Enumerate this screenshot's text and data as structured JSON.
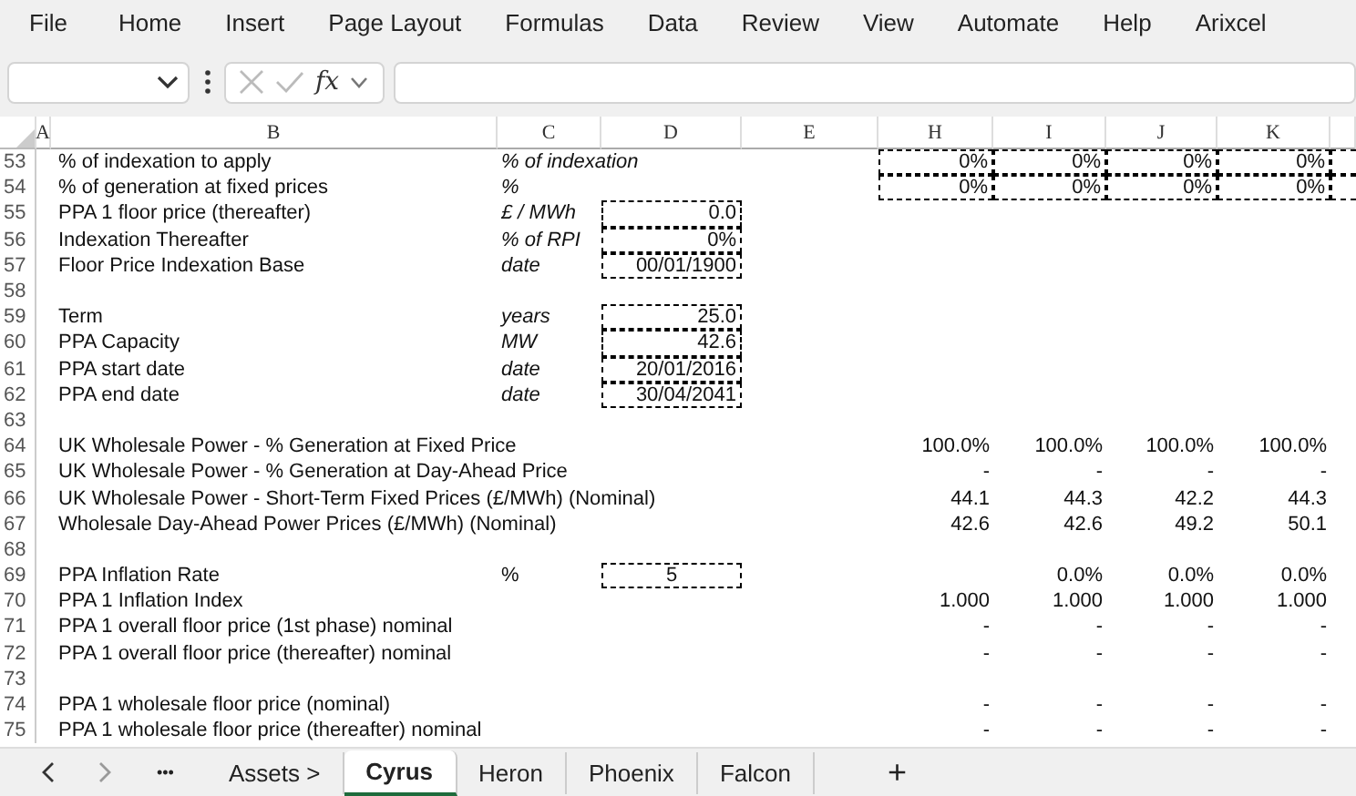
{
  "menu": [
    "File",
    "Home",
    "Insert",
    "Page Layout",
    "Formulas",
    "Data",
    "Review",
    "View",
    "Automate",
    "Help",
    "Arixcel"
  ],
  "formula_bar": {
    "fx": "fx"
  },
  "columns": [
    "A",
    "B",
    "C",
    "D",
    "E",
    "H",
    "I",
    "J",
    "K"
  ],
  "rows": [
    {
      "row": "53",
      "label": "% of indexation to apply",
      "unit": "% of indexation",
      "unit_italic": true,
      "values": [
        "0%",
        "0%",
        "0%",
        "0%"
      ],
      "values_boxed": true
    },
    {
      "row": "54",
      "label": "% of generation at fixed prices",
      "unit": "%",
      "unit_italic": true,
      "values": [
        "0%",
        "0%",
        "0%",
        "0%"
      ],
      "values_boxed": true
    },
    {
      "row": "55",
      "label": "PPA 1 floor price (thereafter)",
      "unit": "£ / MWh",
      "unit_italic": true,
      "d": "0.0",
      "d_boxed": true
    },
    {
      "row": "56",
      "label": "Indexation Thereafter",
      "unit": "% of RPI",
      "unit_italic": true,
      "d": "0%",
      "d_boxed": true
    },
    {
      "row": "57",
      "label": "Floor Price Indexation Base",
      "unit": "date",
      "unit_italic": true,
      "d": "00/01/1900",
      "d_boxed": true
    },
    {
      "row": "58"
    },
    {
      "row": "59",
      "label": "Term",
      "unit": "years",
      "unit_italic": true,
      "d": "25.0",
      "d_boxed": true
    },
    {
      "row": "60",
      "label": "PPA Capacity",
      "unit": "MW",
      "unit_italic": true,
      "d": "42.6",
      "d_boxed": true
    },
    {
      "row": "61",
      "label": "PPA start date",
      "unit": "date",
      "unit_italic": true,
      "d": "20/01/2016",
      "d_boxed": true
    },
    {
      "row": "62",
      "label": "PPA end date",
      "unit": "date",
      "unit_italic": true,
      "d": "30/04/2041",
      "d_boxed": true
    },
    {
      "row": "63"
    },
    {
      "row": "64",
      "label": "UK Wholesale Power - % Generation at Fixed Price",
      "values": [
        "100.0%",
        "100.0%",
        "100.0%",
        "100.0%"
      ]
    },
    {
      "row": "65",
      "label": "UK Wholesale Power - % Generation at Day-Ahead Price",
      "values": [
        "-",
        "-",
        "-",
        "-"
      ]
    },
    {
      "row": "66",
      "label": "UK Wholesale Power - Short-Term Fixed Prices (£/MWh) (Nominal)",
      "values": [
        "44.1",
        "44.3",
        "42.2",
        "44.3"
      ]
    },
    {
      "row": "67",
      "label": "Wholesale Day-Ahead Power Prices (£/MWh) (Nominal)",
      "values": [
        "42.6",
        "42.6",
        "49.2",
        "50.1"
      ]
    },
    {
      "row": "68"
    },
    {
      "row": "69",
      "label": "PPA Inflation Rate",
      "unit": "%",
      "unit_italic": false,
      "d": "5",
      "d_boxed": true,
      "d_centered": true,
      "values": [
        "0.0%",
        "0.0%",
        "0.0%"
      ]
    },
    {
      "row": "70",
      "label": "PPA 1 Inflation Index",
      "values": [
        "1.000",
        "1.000",
        "1.000",
        "1.000"
      ]
    },
    {
      "row": "71",
      "label": "PPA 1 overall floor price (1st phase) nominal",
      "values": [
        "-",
        "-",
        "-",
        "-"
      ]
    },
    {
      "row": "72",
      "label": "PPA 1 overall floor price (thereafter) nominal",
      "values": [
        "-",
        "-",
        "-",
        "-"
      ]
    },
    {
      "row": "73"
    },
    {
      "row": "74",
      "label": "PPA 1 wholesale floor price (nominal)",
      "values": [
        "-",
        "-",
        "-",
        "-"
      ]
    },
    {
      "row": "75",
      "label": "PPA 1 wholesale floor price (thereafter) nominal",
      "values": [
        "-",
        "-",
        "-",
        "-"
      ]
    }
  ],
  "sheet_nav": {
    "more": "•••"
  },
  "sheets": [
    {
      "label": "Assets >",
      "selected": false
    },
    {
      "label": "Cyrus",
      "selected": true
    },
    {
      "label": "Heron",
      "selected": false
    },
    {
      "label": "Phoenix",
      "selected": false
    },
    {
      "label": "Falcon",
      "selected": false
    }
  ],
  "add_sheet": "+"
}
